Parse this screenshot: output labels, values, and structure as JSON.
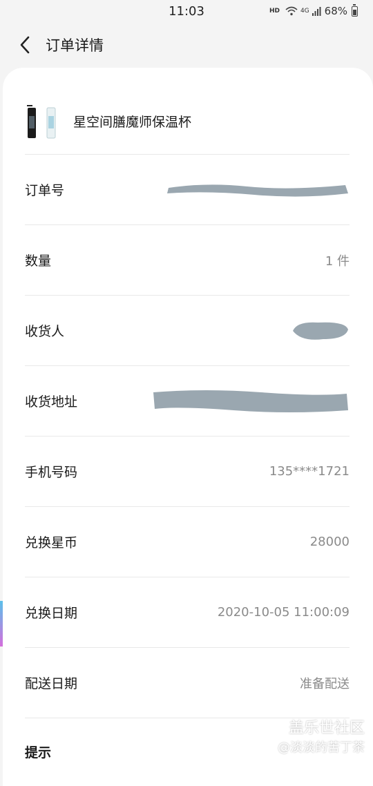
{
  "status_bar": {
    "time": "11:03",
    "hd": "HD",
    "network": "4G",
    "battery": "68%"
  },
  "header": {
    "title": "订单详情"
  },
  "product": {
    "name": "星空间膳魔师保温杯"
  },
  "details": [
    {
      "label": "订单号",
      "value": "",
      "redacted": true
    },
    {
      "label": "数量",
      "value": "1 件"
    },
    {
      "label": "收货人",
      "value": "",
      "redacted": true
    },
    {
      "label": "收货地址",
      "value": "",
      "redacted": true
    },
    {
      "label": "手机号码",
      "value": "135****1721"
    },
    {
      "label": "兑换星币",
      "value": "28000"
    },
    {
      "label": "兑换日期",
      "value": "2020-10-05 11:00:09"
    },
    {
      "label": "配送日期",
      "value": "准备配送"
    }
  ],
  "hint_label": "提示",
  "watermark": {
    "title": "盖乐世社区",
    "author": "@淡淡的苦丁茶"
  },
  "colors": {
    "background": "#f4f4f4",
    "card": "#ffffff",
    "value_text": "#8a8a8a",
    "redaction": "#9aa7b0"
  }
}
